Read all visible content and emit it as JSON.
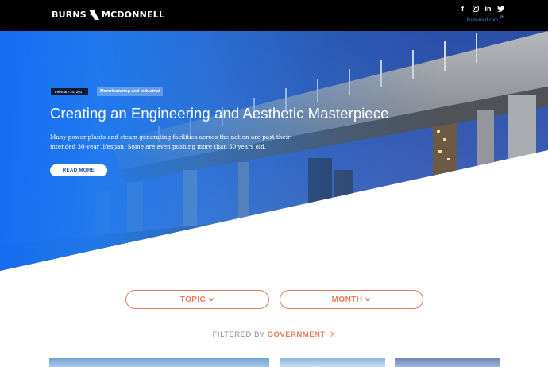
{
  "header": {
    "logo_left": "BURNS",
    "logo_right": "MCDONNELL",
    "site_link": "burnsmcd.com",
    "social": [
      {
        "icon": "facebook-icon",
        "glyph": "f"
      },
      {
        "icon": "instagram-icon",
        "glyph": "◎"
      },
      {
        "icon": "linkedin-icon",
        "glyph": "in"
      },
      {
        "icon": "twitter-icon",
        "glyph": "🐦"
      }
    ]
  },
  "hero": {
    "date": "February 20, 2017",
    "category": "Manufacturing and Industrial",
    "title": "Creating an Engineering and Aesthetic Masterpiece",
    "text": "Many power plants and steam generating facilities across the nation are past their intended 30-year lifespan. Some are even pushing more than 50 years old.",
    "cta": "READ MORE"
  },
  "filters": {
    "topic_label": "TOPIC",
    "month_label": "MONTH",
    "filtered_by_label": "FILTERED BY",
    "filtered_value": "GOVERNMENT",
    "clear_glyph": "X"
  },
  "colors": {
    "accent": "#e97a5a",
    "hero_blue": "#1e7df5",
    "topbar": "#000000",
    "link": "#3a8fe0"
  }
}
